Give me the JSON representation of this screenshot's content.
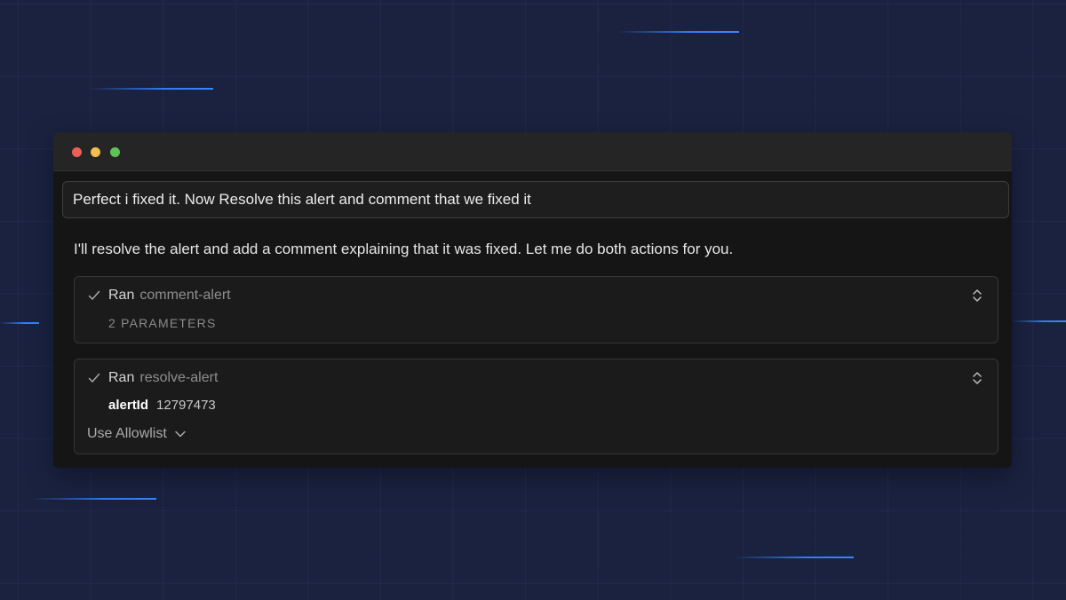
{
  "prompt": {
    "text": "Perfect i fixed it. Now Resolve this alert and comment that we fixed it"
  },
  "reply": {
    "text": "I'll resolve the alert and add a comment explaining that it was fixed. Let me do both actions for you."
  },
  "tool_calls": [
    {
      "status_icon": "check-icon",
      "prefix": "Ran",
      "name": "comment-alert",
      "summary": "2 PARAMETERS"
    },
    {
      "status_icon": "check-icon",
      "prefix": "Ran",
      "name": "resolve-alert",
      "param_key": "alertId",
      "param_value": "12797473",
      "allowlist_label": "Use Allowlist"
    }
  ],
  "colors": {
    "background": "#1a2240",
    "window": "#151515",
    "titlebar": "#252525",
    "accent_streak": "#2f7cf0",
    "close_dot": "#ec5f57",
    "minimize_dot": "#f3be4f",
    "zoom_dot": "#5fc454"
  }
}
